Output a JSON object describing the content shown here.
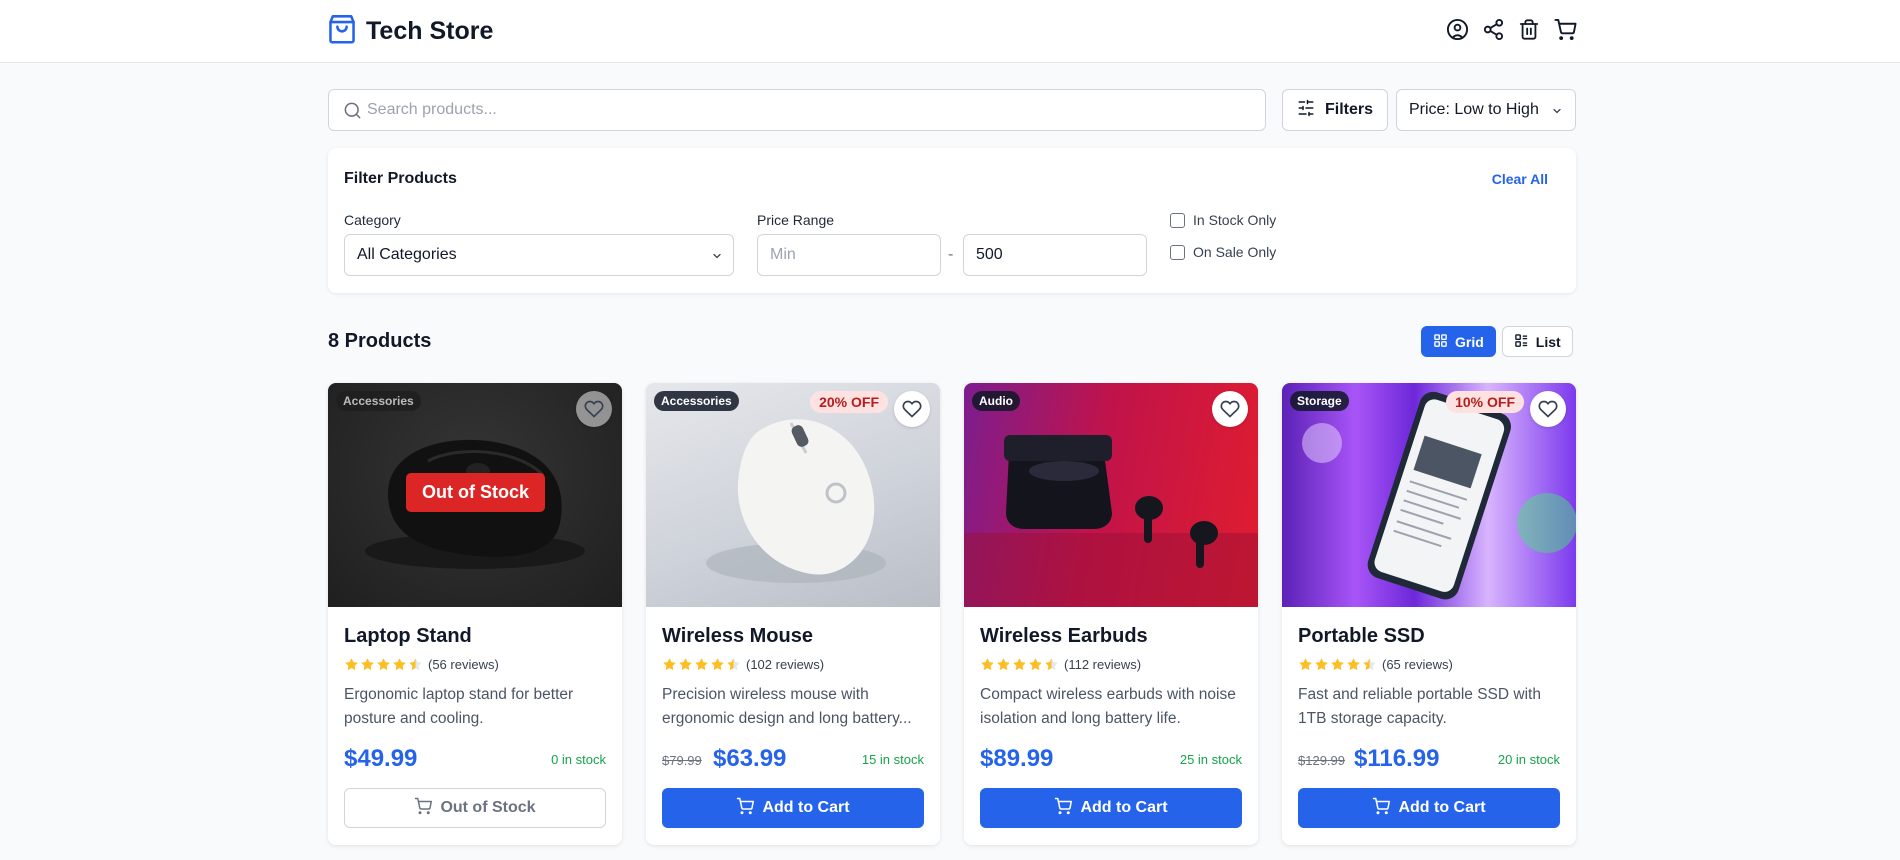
{
  "header": {
    "title": "Tech Store",
    "icons": [
      "shopping-bag-icon",
      "user-icon",
      "share-icon",
      "trash-icon",
      "cart-icon"
    ]
  },
  "search": {
    "placeholder": "Search products...",
    "value": ""
  },
  "toolbar": {
    "filters_label": "Filters",
    "sort_value": "Price: Low to High"
  },
  "filter_panel": {
    "title": "Filter Products",
    "clear_label": "Clear All",
    "category_label": "Category",
    "category_value": "All Categories",
    "price_label": "Price Range",
    "price_min_placeholder": "Min",
    "price_min_value": "",
    "price_max_value": "500",
    "price_separator": "-",
    "in_stock_label": "In Stock Only",
    "in_stock_checked": false,
    "on_sale_label": "On Sale Only",
    "on_sale_checked": false
  },
  "results": {
    "count_label": "8 Products",
    "view_grid_label": "Grid",
    "view_list_label": "List",
    "active_view": "grid"
  },
  "products": [
    {
      "category": "Accessories",
      "name": "Laptop Stand",
      "rating": 4.5,
      "reviews": "(56 reviews)",
      "description": "Ergonomic laptop stand for better posture and cooling.",
      "old_price": "",
      "price": "$49.99",
      "stock": "0 in stock",
      "out_of_stock_label": "Out of Stock",
      "button_label": "Out of Stock",
      "in_stock": false
    },
    {
      "category": "Accessories",
      "name": "Wireless Mouse",
      "sale": "20% OFF",
      "rating": 4.5,
      "reviews": "(102 reviews)",
      "description": "Precision wireless mouse with ergonomic design and long battery...",
      "old_price": "$79.99",
      "price": "$63.99",
      "stock": "15 in stock",
      "button_label": "Add to Cart",
      "in_stock": true
    },
    {
      "category": "Audio",
      "name": "Wireless Earbuds",
      "rating": 4.5,
      "reviews": "(112 reviews)",
      "description": "Compact wireless earbuds with noise isolation and long battery life.",
      "old_price": "",
      "price": "$89.99",
      "stock": "25 in stock",
      "button_label": "Add to Cart",
      "in_stock": true
    },
    {
      "category": "Storage",
      "name": "Portable SSD",
      "sale": "10% OFF",
      "rating": 4.5,
      "reviews": "(65 reviews)",
      "description": "Fast and reliable portable SSD with 1TB storage capacity.",
      "old_price": "$129.99",
      "price": "$116.99",
      "stock": "20 in stock",
      "button_label": "Add to Cart",
      "in_stock": true
    }
  ],
  "colors": {
    "accent": "#2563eb",
    "sale_text": "#b91c1c",
    "stock_text": "#16a34a",
    "star": "#fbbf24",
    "out_of_stock": "#dc2626"
  }
}
